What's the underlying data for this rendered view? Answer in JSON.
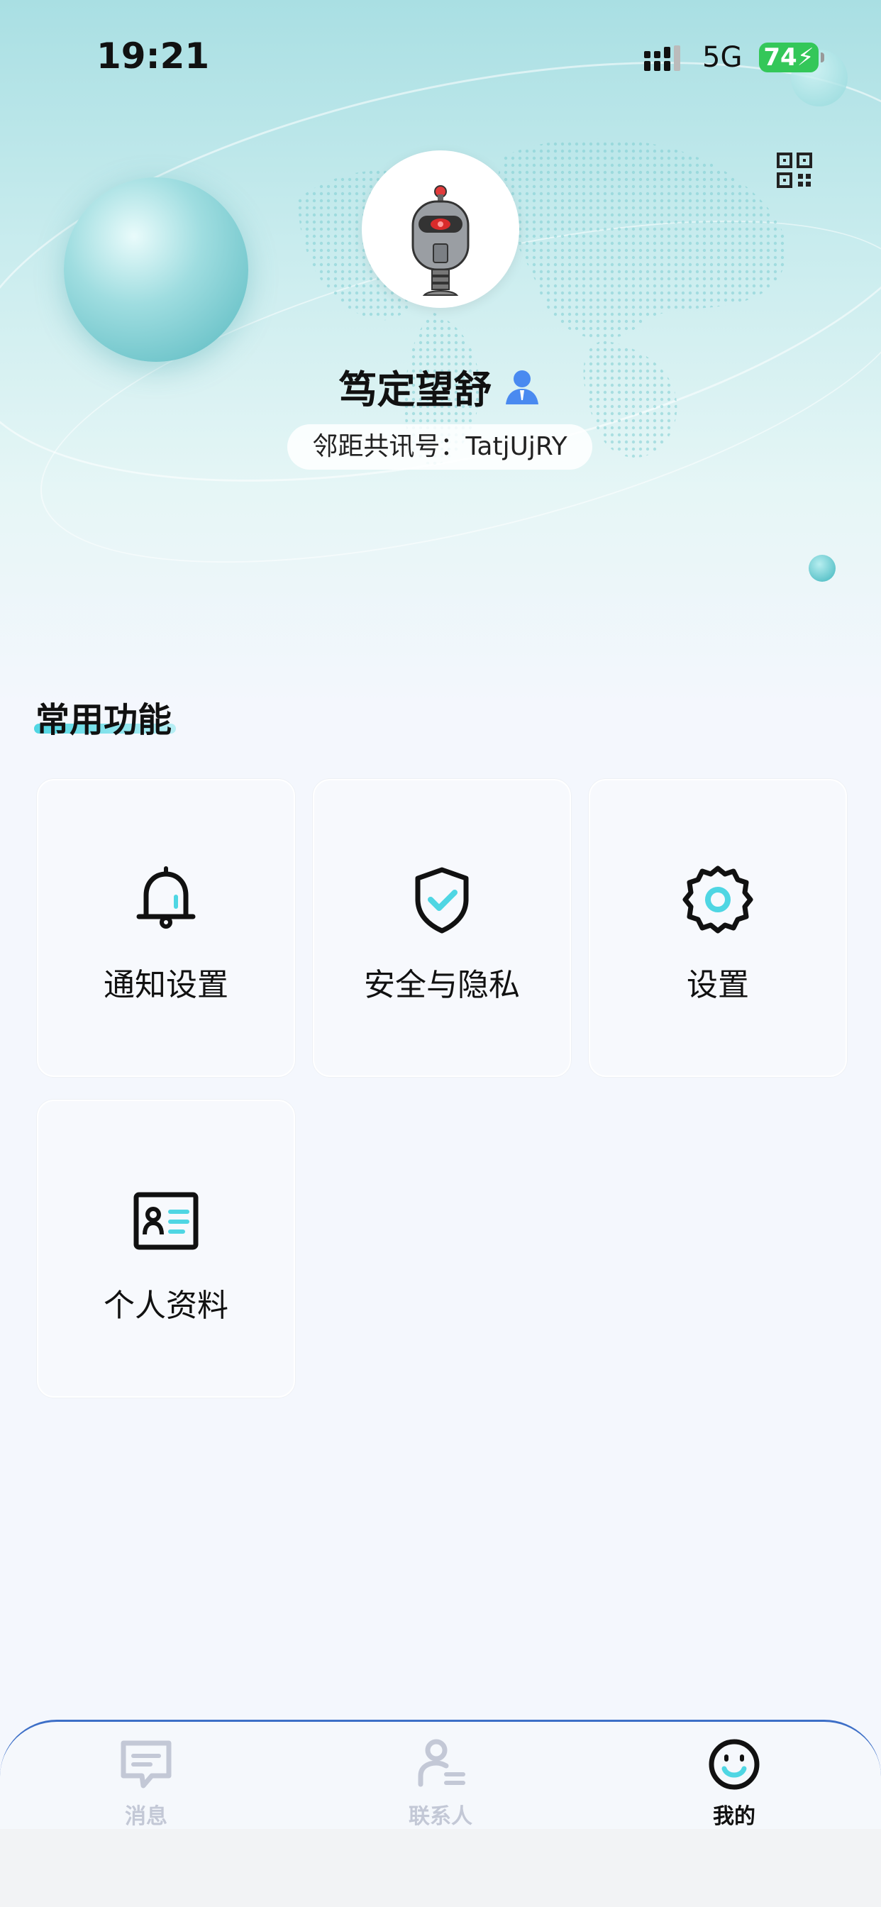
{
  "status_bar": {
    "time": "19:21",
    "network": "5G",
    "battery": "74"
  },
  "profile": {
    "name": "笃定望舒",
    "account_label": "邻距共讯号：",
    "account_id": "TatjUjRY"
  },
  "section": {
    "title": "常用功能"
  },
  "functions": [
    {
      "label": "通知设置",
      "icon": "bell-icon"
    },
    {
      "label": "安全与隐私",
      "icon": "shield-check-icon"
    },
    {
      "label": "设置",
      "icon": "gear-icon"
    },
    {
      "label": "个人资料",
      "icon": "id-card-icon"
    }
  ],
  "tab_bar": {
    "items": [
      {
        "label": "消息",
        "icon": "message-icon",
        "active": false
      },
      {
        "label": "联系人",
        "icon": "contacts-icon",
        "active": false
      },
      {
        "label": "我的",
        "icon": "smile-icon",
        "active": true
      }
    ]
  },
  "colors": {
    "accent": "#4fd6e3",
    "tab_border": "#3d6fc7",
    "battery": "#34c759"
  }
}
